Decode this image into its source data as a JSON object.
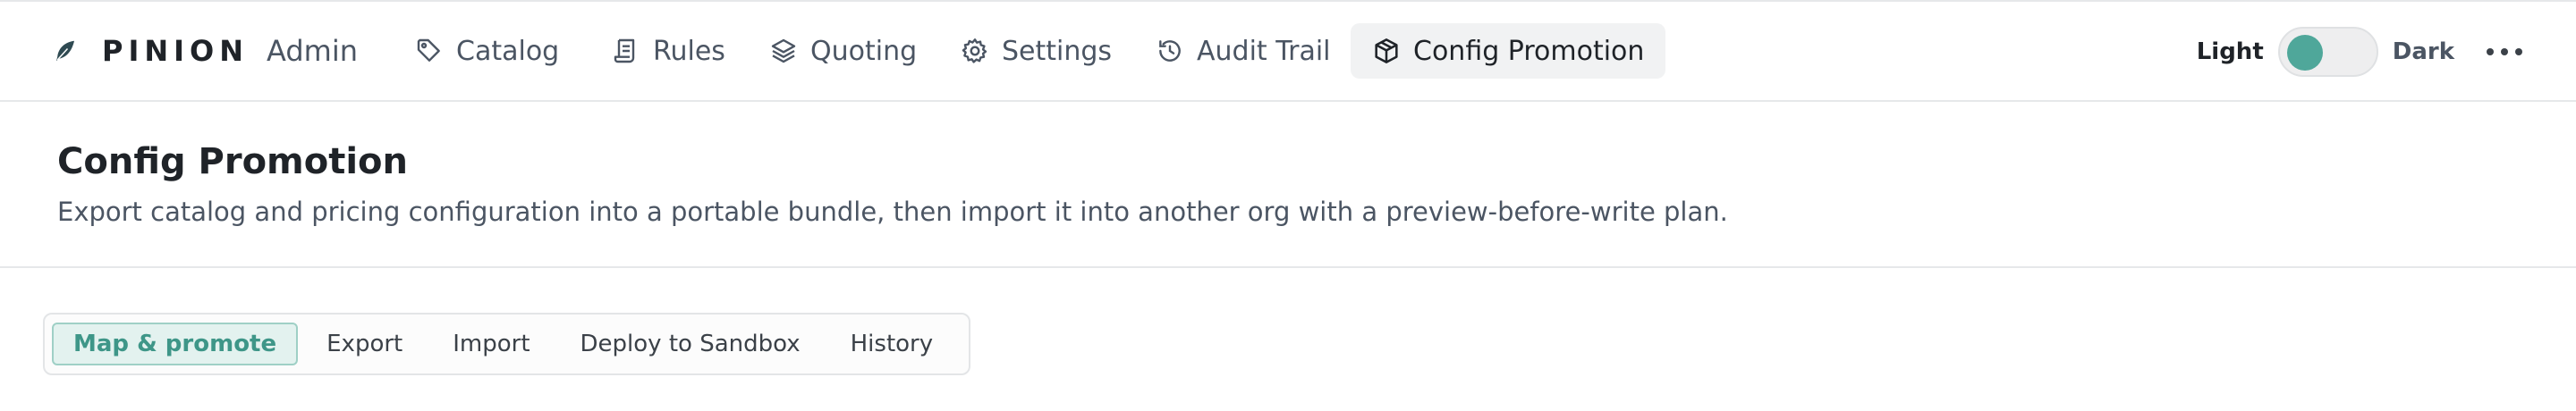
{
  "app": {
    "brand_name": "PINION",
    "brand_sub": "Admin",
    "logo_icon": "feather-icon"
  },
  "nav": [
    {
      "label": "Catalog",
      "icon": "tag-icon"
    },
    {
      "label": "Rules",
      "icon": "scroll-icon"
    },
    {
      "label": "Quoting",
      "icon": "layers-icon"
    },
    {
      "label": "Settings",
      "icon": "gear-icon"
    },
    {
      "label": "Audit Trail",
      "icon": "history-icon"
    },
    {
      "label": "Config Promotion",
      "icon": "package-icon",
      "active": true
    }
  ],
  "theme": {
    "light_label": "Light",
    "dark_label": "Dark",
    "selected": "Light"
  },
  "page": {
    "title": "Config Promotion",
    "description": "Export catalog and pricing configuration into a portable bundle, then import it into another org with a preview-before-write plan."
  },
  "tabs": [
    {
      "label": "Map & promote",
      "active": true
    },
    {
      "label": "Export"
    },
    {
      "label": "Import"
    },
    {
      "label": "Deploy to Sandbox"
    },
    {
      "label": "History"
    }
  ],
  "colors": {
    "accent": "#4fa79a",
    "accent_bg": "#e3f2ef",
    "text": "#1f2328",
    "muted": "#4b5563",
    "border": "#e6e8ea"
  }
}
